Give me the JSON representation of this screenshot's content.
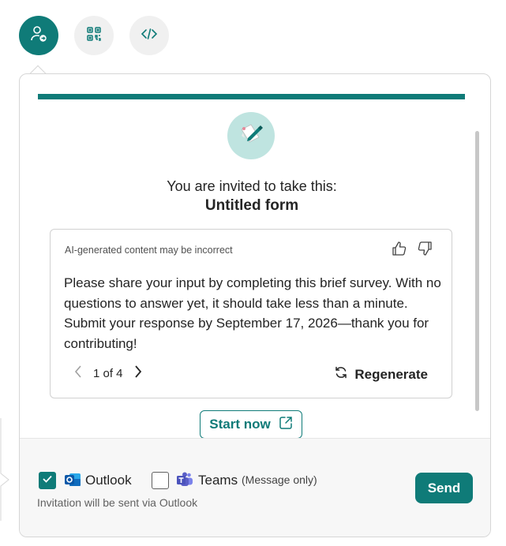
{
  "top_icons": [
    {
      "name": "share-person",
      "state": "active"
    },
    {
      "name": "qr-code",
      "state": "inactive"
    },
    {
      "name": "embed-code",
      "state": "inactive"
    }
  ],
  "invite": {
    "intro": "You are invited to take this:",
    "form_title": "Untitled form"
  },
  "ai_card": {
    "disclaimer": "AI-generated content may be incorrect",
    "message": "Please share your input by completing this brief survey. With no questions to answer yet, it should take less than a minute. Submit your response by September 17, 2026—thank you for contributing!",
    "pager_text": "1 of 4",
    "regenerate_label": "Regenerate"
  },
  "start_button": {
    "label": "Start now"
  },
  "footer": {
    "outlook": {
      "label": "Outlook",
      "checked": true
    },
    "teams": {
      "label": "Teams",
      "note": "(Message only)",
      "checked": false
    },
    "via_note": "Invitation will be sent via Outlook",
    "send_label": "Send"
  },
  "colors": {
    "accent": "#0f7b78",
    "icon_bg": "#bfe4e0",
    "outlook_blue": "#0f6cbd",
    "teams_purple": "#5b5fc7"
  }
}
